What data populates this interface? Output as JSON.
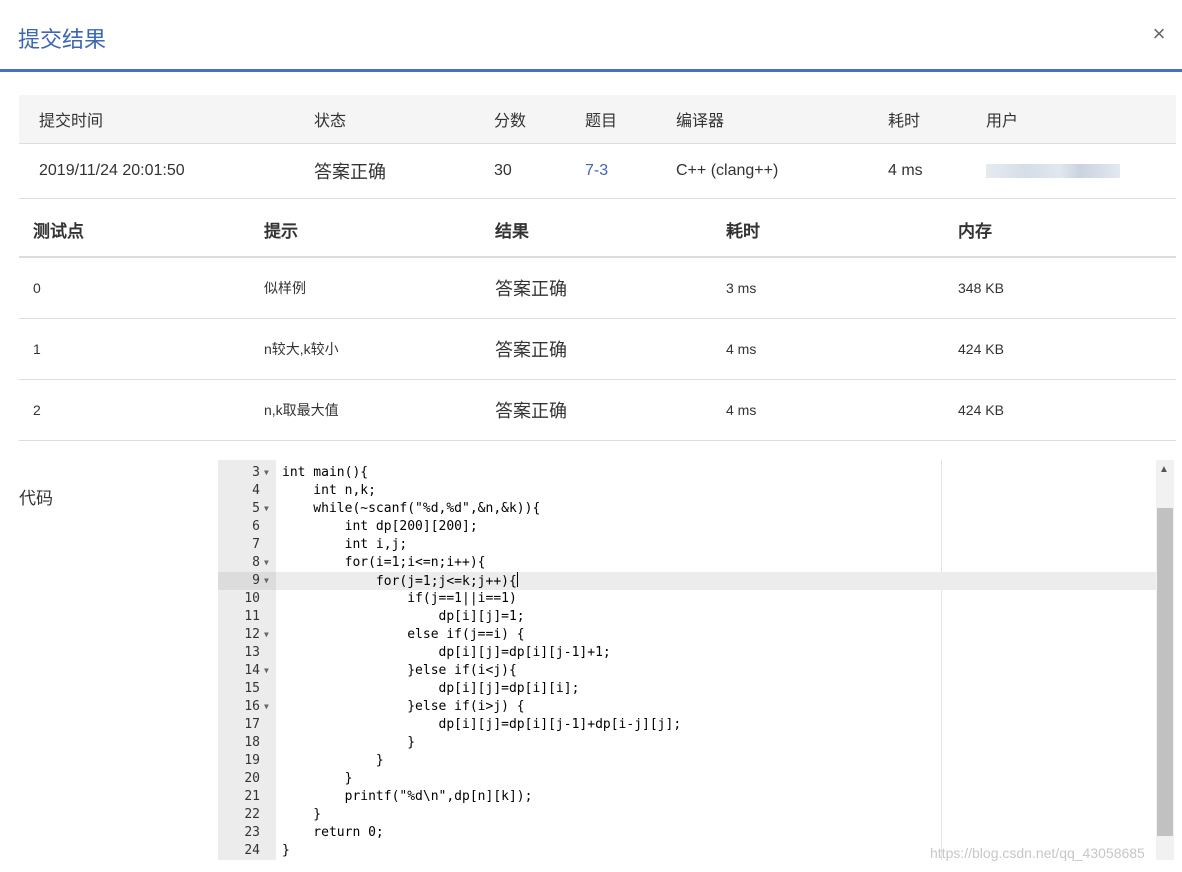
{
  "modal": {
    "title": "提交结果",
    "close_label": "×"
  },
  "summary": {
    "headers": [
      "提交时间",
      "状态",
      "分数",
      "题目",
      "编译器",
      "耗时",
      "用户"
    ],
    "row": {
      "time": "2019/11/24 20:01:50",
      "status": "答案正确",
      "score": "30",
      "problem": "7-3",
      "compiler": "C++ (clang++)",
      "elapsed": "4 ms"
    }
  },
  "cases": {
    "headers": [
      "测试点",
      "提示",
      "结果",
      "耗时",
      "内存"
    ],
    "rows": [
      {
        "id": "0",
        "hint": "似样例",
        "result": "答案正确",
        "time": "3 ms",
        "memory": "348 KB"
      },
      {
        "id": "1",
        "hint": "n较大,k较小",
        "result": "答案正确",
        "time": "4 ms",
        "memory": "424 KB"
      },
      {
        "id": "2",
        "hint": "n,k取最大值",
        "result": "答案正确",
        "time": "4 ms",
        "memory": "424 KB"
      }
    ]
  },
  "code_section": {
    "label": "代码"
  },
  "editor": {
    "active_line": 9,
    "lines": [
      {
        "n": "3",
        "fold": true,
        "text": "int main(){"
      },
      {
        "n": "4",
        "fold": false,
        "text": "    int n,k;"
      },
      {
        "n": "5",
        "fold": true,
        "text": "    while(~scanf(\"%d,%d\",&n,&k)){"
      },
      {
        "n": "6",
        "fold": false,
        "text": "        int dp[200][200];"
      },
      {
        "n": "7",
        "fold": false,
        "text": "        int i,j;"
      },
      {
        "n": "8",
        "fold": true,
        "text": "        for(i=1;i<=n;i++){"
      },
      {
        "n": "9",
        "fold": true,
        "text": "            for(j=1;j<=k;j++){"
      },
      {
        "n": "10",
        "fold": false,
        "text": "                if(j==1||i==1)"
      },
      {
        "n": "11",
        "fold": false,
        "text": "                    dp[i][j]=1;"
      },
      {
        "n": "12",
        "fold": true,
        "text": "                else if(j==i) {"
      },
      {
        "n": "13",
        "fold": false,
        "text": "                    dp[i][j]=dp[i][j-1]+1;"
      },
      {
        "n": "14",
        "fold": true,
        "text": "                }else if(i<j){"
      },
      {
        "n": "15",
        "fold": false,
        "text": "                    dp[i][j]=dp[i][i];"
      },
      {
        "n": "16",
        "fold": true,
        "text": "                }else if(i>j) {"
      },
      {
        "n": "17",
        "fold": false,
        "text": "                    dp[i][j]=dp[i][j-1]+dp[i-j][j];"
      },
      {
        "n": "18",
        "fold": false,
        "text": "                }"
      },
      {
        "n": "19",
        "fold": false,
        "text": "            }"
      },
      {
        "n": "20",
        "fold": false,
        "text": "        }"
      },
      {
        "n": "21",
        "fold": false,
        "text": "        printf(\"%d\\n\",dp[n][k]);"
      },
      {
        "n": "22",
        "fold": false,
        "text": "    }"
      },
      {
        "n": "23",
        "fold": false,
        "text": "    return 0;"
      },
      {
        "n": "24",
        "fold": false,
        "text": "}"
      }
    ]
  },
  "scrollbar": {
    "up_icon": "▲"
  },
  "watermark": "https://blog.csdn.net/qq_43058685",
  "colors": {
    "accent": "#3d66b5",
    "accepted": "#e13a3a"
  }
}
